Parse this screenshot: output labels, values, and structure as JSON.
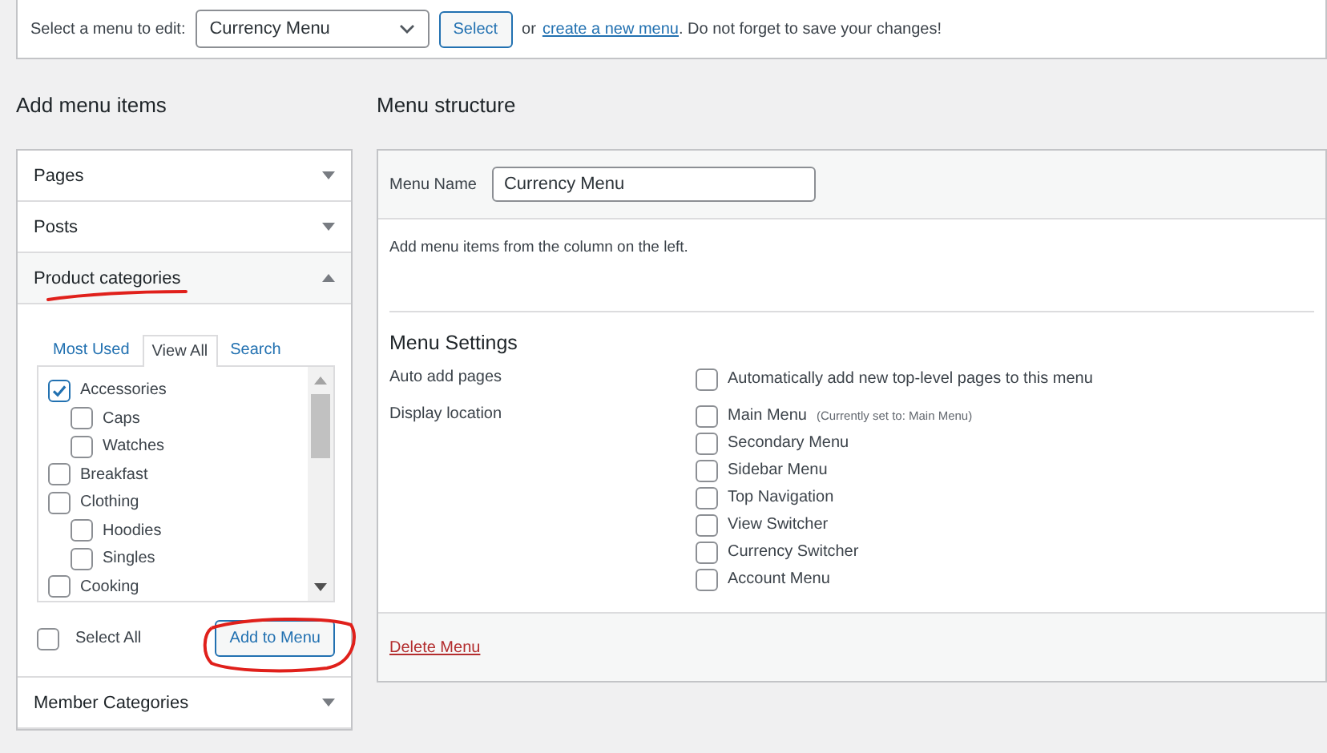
{
  "top_bar": {
    "label": "Select a menu to edit:",
    "menu_select": {
      "value": "Currency Menu"
    },
    "select_button": "Select",
    "or_text": "or",
    "create_link": "create a new menu",
    "tail_text": ". Do not forget to save your changes!"
  },
  "add_items": {
    "title": "Add menu items",
    "sections": [
      {
        "title": "Pages",
        "expanded": false
      },
      {
        "title": "Posts",
        "expanded": false
      },
      {
        "title": "Product categories",
        "expanded": true,
        "tabs": [
          {
            "label": "Most Used",
            "selected": false
          },
          {
            "label": "View All",
            "selected": true
          },
          {
            "label": "Search",
            "selected": false
          }
        ],
        "items": [
          {
            "label": "Accessories",
            "checked": true,
            "children": [
              {
                "label": "Caps",
                "checked": false
              },
              {
                "label": "Watches",
                "checked": false
              }
            ]
          },
          {
            "label": "Breakfast",
            "checked": false
          },
          {
            "label": "Clothing",
            "checked": false,
            "children": [
              {
                "label": "Hoodies",
                "checked": false
              },
              {
                "label": "Singles",
                "checked": false
              }
            ]
          },
          {
            "label": "Cooking",
            "checked": false
          }
        ],
        "select_all": {
          "label": "Select All",
          "checked": false
        },
        "add_button": "Add to Menu"
      },
      {
        "title": "Member Categories",
        "expanded": false
      }
    ]
  },
  "structure": {
    "title": "Menu structure",
    "menu_name": {
      "label": "Menu Name",
      "value": "Currency Menu"
    },
    "hint": "Add menu items from the column on the left.",
    "settings": {
      "title": "Menu Settings",
      "rows": [
        {
          "label": "Auto add pages",
          "options": [
            {
              "label": "Automatically add new top-level pages to this menu",
              "checked": false
            }
          ]
        },
        {
          "label": "Display location",
          "options": [
            {
              "label": "Main Menu",
              "note": "(Currently set to: Main Menu)",
              "checked": false
            },
            {
              "label": "Secondary Menu",
              "checked": false
            },
            {
              "label": "Sidebar Menu",
              "checked": false
            },
            {
              "label": "Top Navigation",
              "checked": false
            },
            {
              "label": "View Switcher",
              "checked": false
            },
            {
              "label": "Currency Switcher",
              "checked": false
            },
            {
              "label": "Account Menu",
              "checked": false
            }
          ]
        }
      ]
    },
    "delete_link": "Delete Menu"
  }
}
